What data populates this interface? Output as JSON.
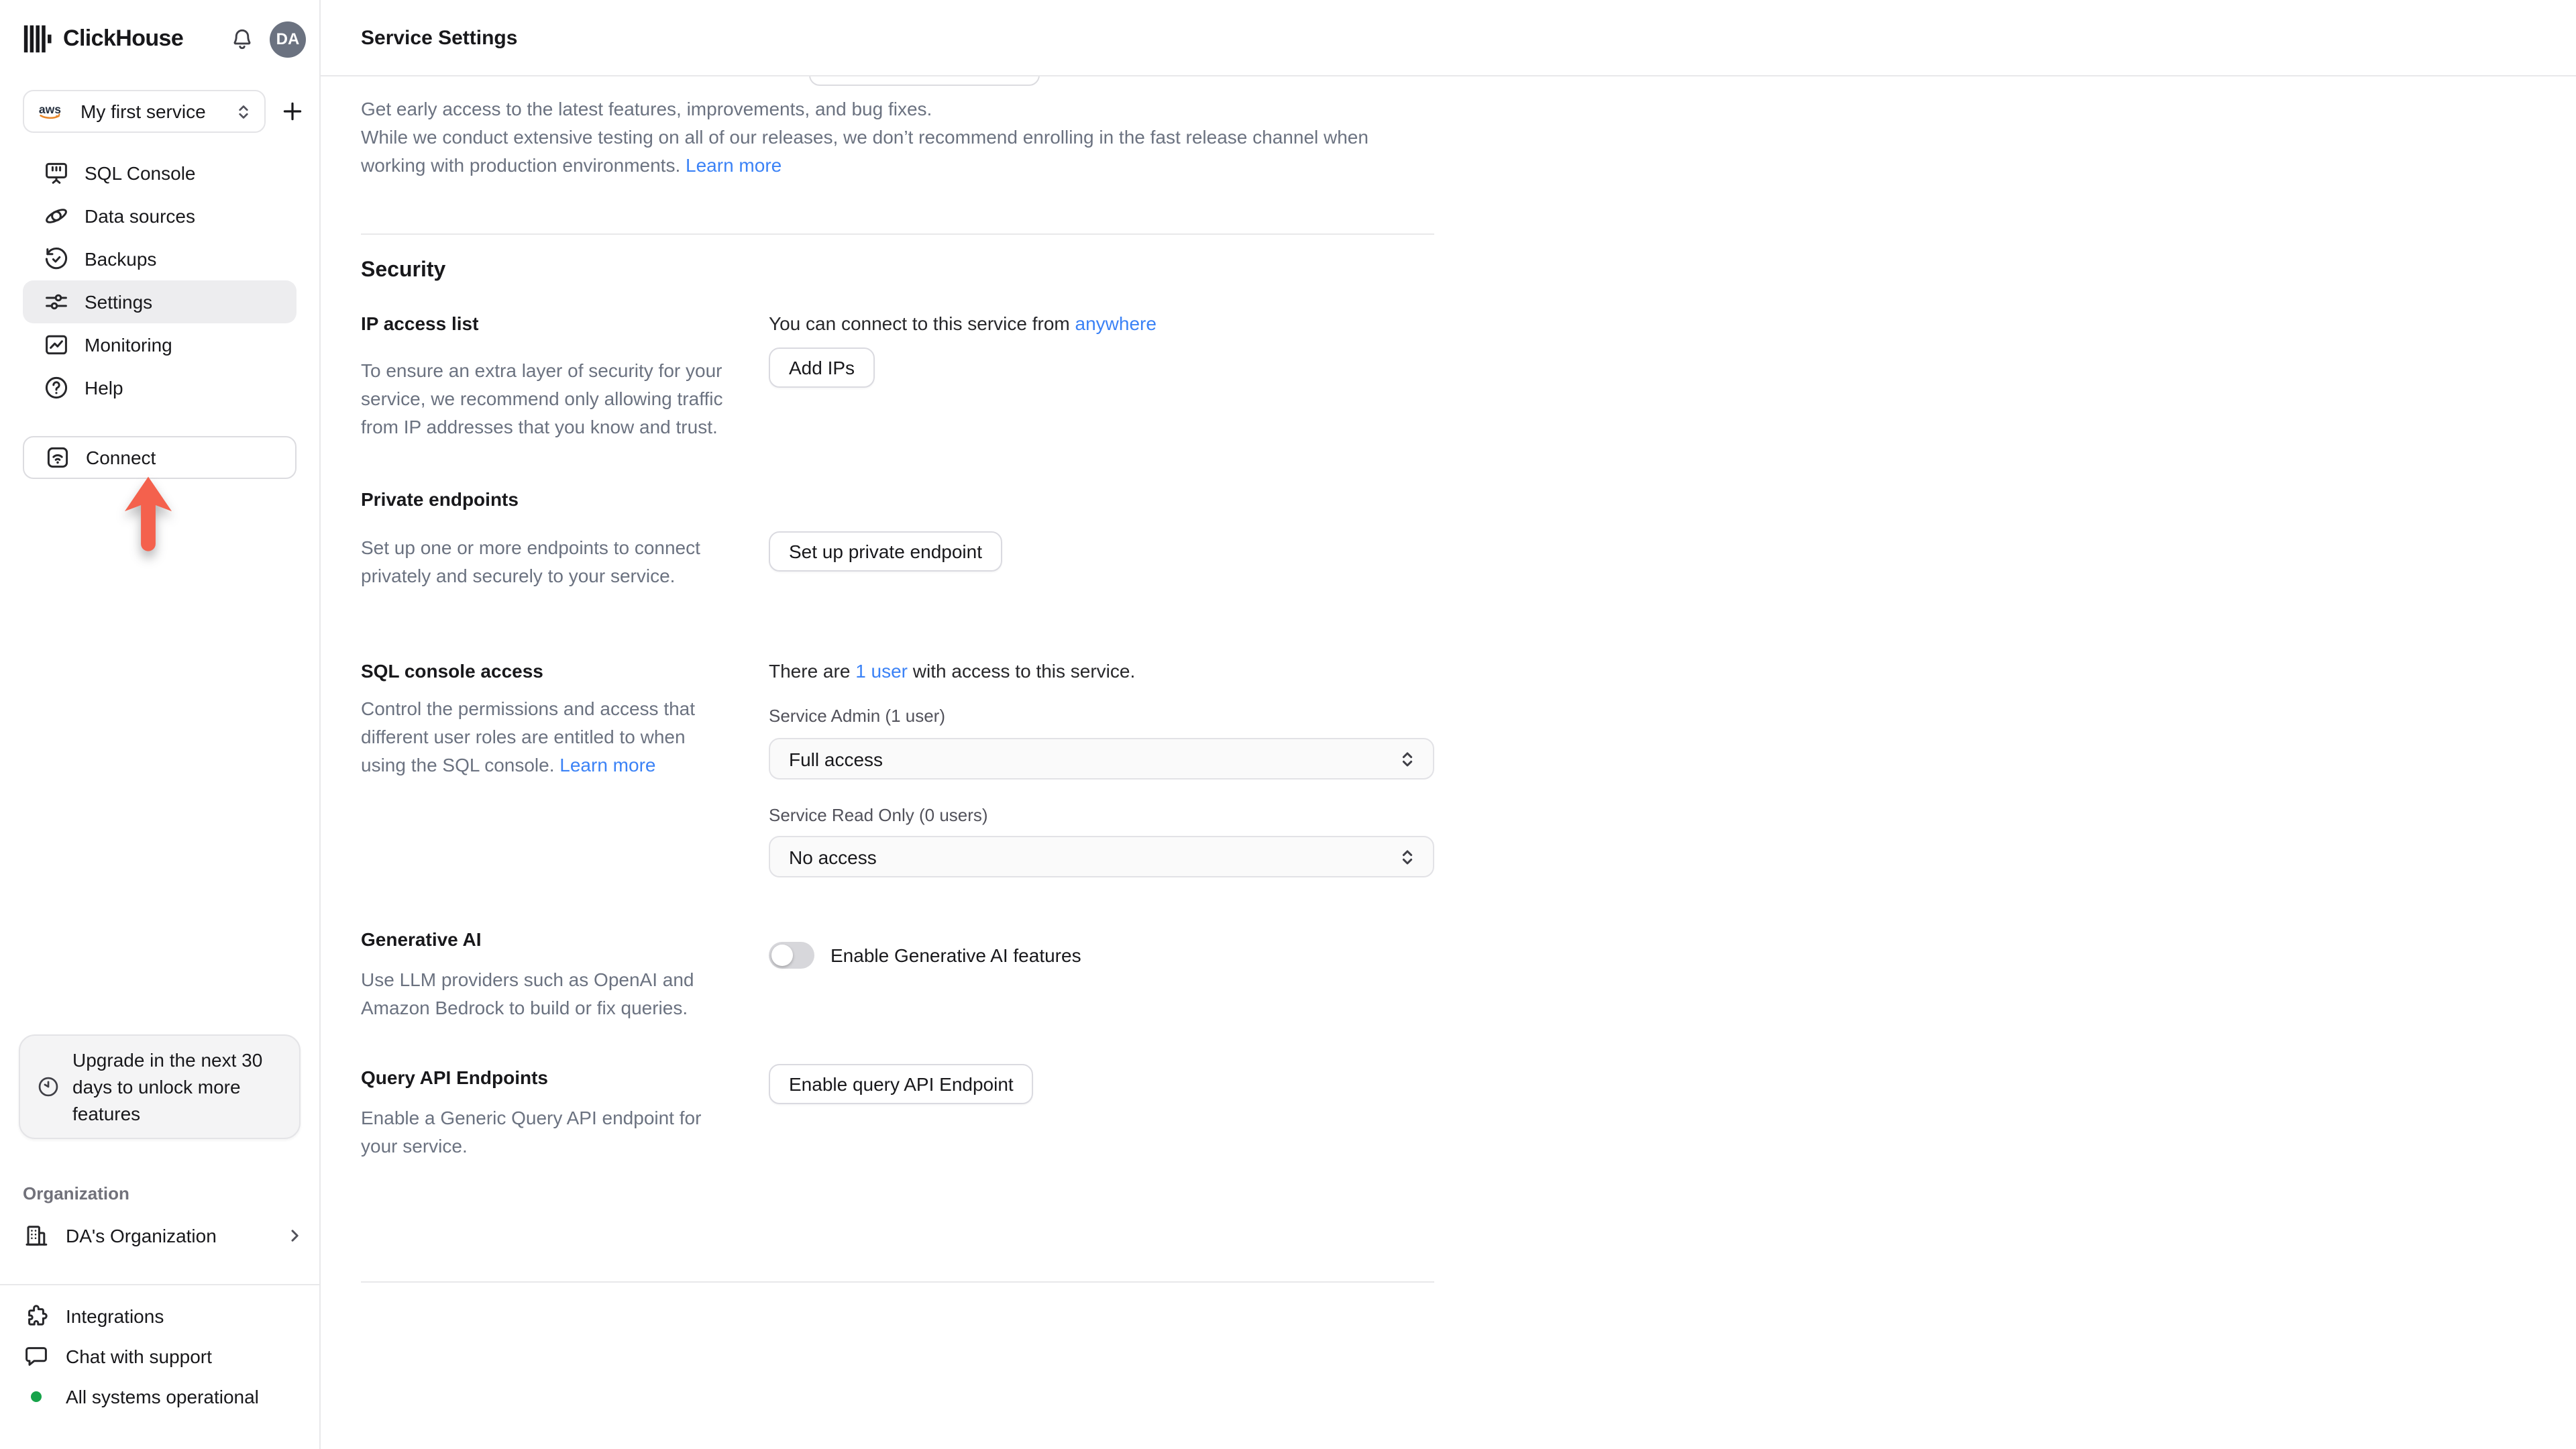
{
  "brand": "ClickHouse",
  "avatar_initials": "DA",
  "colors": {
    "link_blue": "#3b82f6",
    "arrow_red": "#f4614d",
    "status_green": "#17a34a",
    "active_nav_bg": "#ededef"
  },
  "sidebar": {
    "service_selector": {
      "label": "My first service",
      "provider_icon": "aws-logo"
    },
    "nav": [
      {
        "label": "SQL Console"
      },
      {
        "label": "Data sources"
      },
      {
        "label": "Backups"
      },
      {
        "label": "Settings",
        "active": true
      },
      {
        "label": "Monitoring"
      },
      {
        "label": "Help"
      }
    ],
    "connect_label": "Connect",
    "upgrade_notice": "Upgrade in the next 30 days to unlock more features",
    "organization_label": "Organization",
    "organization_name": "DA's Organization",
    "footer": [
      {
        "label": "Integrations"
      },
      {
        "label": "Chat with support"
      },
      {
        "label": "All systems operational"
      }
    ]
  },
  "header": {
    "title": "Service Settings"
  },
  "release_channel": {
    "p1": "Get early access to the latest features, improvements, and bug fixes.",
    "p2": "While we conduct extensive testing on all of our releases, we don’t recommend enrolling in the fast release channel when working with production environments. ",
    "learn_more": "Learn more"
  },
  "security": {
    "heading": "Security",
    "ip_access": {
      "title": "IP access list",
      "description": "To ensure an extra layer of security for your service, we recommend only allowing traffic from IP addresses that you know and trust.",
      "status_before": "You can connect to this service from ",
      "status_link": "anywhere",
      "button": "Add IPs"
    },
    "private_endpoints": {
      "title": "Private endpoints",
      "description": "Set up one or more endpoints to connect privately and securely to your service.",
      "button": "Set up private endpoint"
    },
    "sql_console_access": {
      "title": "SQL console access",
      "description": "Control the permissions and access that different user roles are entitled to when using the SQL console. ",
      "learn_more": "Learn more",
      "status_before": "There are ",
      "status_link": "1 user",
      "status_after": " with access to this service.",
      "admin_label": "Service Admin (1 user)",
      "admin_value": "Full access",
      "readonly_label": "Service Read Only (0 users)",
      "readonly_value": "No access"
    },
    "generative_ai": {
      "title": "Generative AI",
      "description": "Use LLM providers such as OpenAI and Amazon Bedrock to build or fix queries.",
      "toggle_label": "Enable Generative AI features",
      "toggle_state": "off"
    },
    "query_api": {
      "title": "Query API Endpoints",
      "description": "Enable a Generic Query API endpoint for your service.",
      "button": "Enable query API Endpoint"
    }
  }
}
